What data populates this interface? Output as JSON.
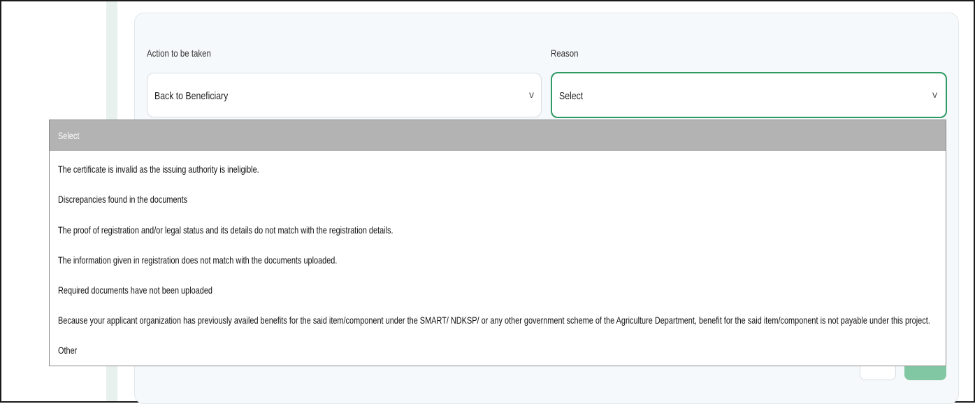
{
  "form": {
    "action": {
      "label": "Action to be taken",
      "value": "Back to Beneficiary",
      "icon": "chevron-down-icon"
    },
    "reason": {
      "label": "Reason",
      "value": "Select",
      "icon": "chevron-down-icon"
    }
  },
  "reason_dropdown": {
    "options": [
      "Select",
      "The certificate is invalid as the issuing authority is ineligible.",
      "Discrepancies found in the documents",
      "The proof of registration and/or legal status and its details do not match with the registration details.",
      "The information given in registration does not match with the documents uploaded.",
      "Required documents have not been uploaded",
      "Because your applicant organization has previously availed benefits for the said item/component under the SMART/ NDKSP/ or any other government scheme of the Agriculture Department, benefit for the said item/component is not payable under this project.",
      "Other"
    ],
    "selected_index": 0
  },
  "colors": {
    "focus_border": "#2e9a63",
    "primary_button": "#82c7a4",
    "selected_option": "#b3b3b3"
  }
}
